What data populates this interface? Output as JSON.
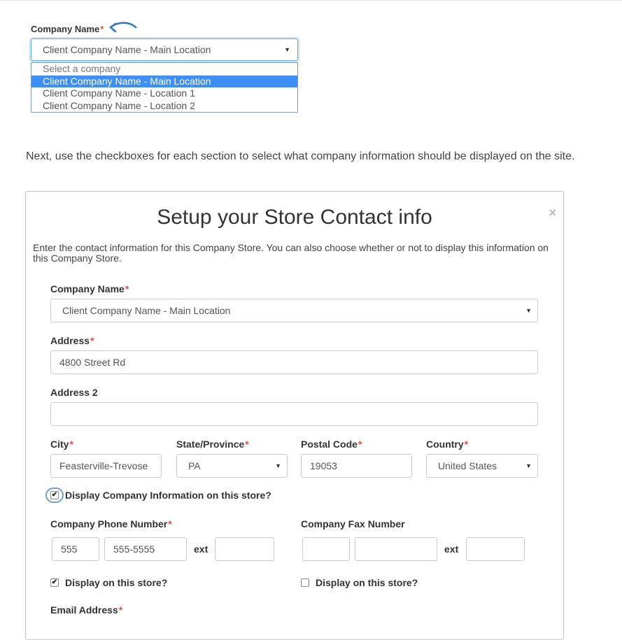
{
  "demo": {
    "label": "Company Name",
    "required_mark": "*",
    "selected_value": "Client Company Name - Main Location",
    "options": [
      {
        "label": "Select a company",
        "state": "placeholder"
      },
      {
        "label": "Client Company Name - Main Location",
        "state": "selected"
      },
      {
        "label": "Client Company Name - Location 1",
        "state": "normal"
      },
      {
        "label": "Client Company Name - Location 2",
        "state": "normal"
      }
    ],
    "arrow_color": "#2a7bc4"
  },
  "instructions": "Next, use the checkboxes for each section to select what company information should be displayed on the site.",
  "modal": {
    "title": "Setup your Store Contact info",
    "close_glyph": "×",
    "description": "Enter the contact information for this Company Store. You can also choose whether or not to display this information on this Company Store.",
    "required_mark": "*",
    "company_name": {
      "label": "Company Name",
      "value": "Client Company Name - Main Location"
    },
    "address": {
      "label": "Address",
      "value": "4800 Street Rd"
    },
    "address2": {
      "label": "Address 2",
      "value": ""
    },
    "city": {
      "label": "City",
      "value": "Feasterville-Trevose"
    },
    "state": {
      "label": "State/Province",
      "value": "PA"
    },
    "postal": {
      "label": "Postal Code",
      "value": "19053"
    },
    "country": {
      "label": "Country",
      "value": "United States"
    },
    "display_company_info": {
      "label": "Display Company Information on this store?",
      "checked": true
    },
    "phone": {
      "label": "Company Phone Number",
      "area": "555",
      "number": "555-5555",
      "ext_label": "ext",
      "ext": "",
      "display": {
        "label": "Display on this store?",
        "checked": true
      }
    },
    "fax": {
      "label": "Company Fax Number",
      "area": "",
      "number": "",
      "ext_label": "ext",
      "ext": "",
      "display": {
        "label": "Display on this store?",
        "checked": false
      }
    },
    "email": {
      "label": "Email Address"
    },
    "checkmark_glyph": "✔",
    "caret_glyph": "▼",
    "required_color": "#d9534f"
  }
}
